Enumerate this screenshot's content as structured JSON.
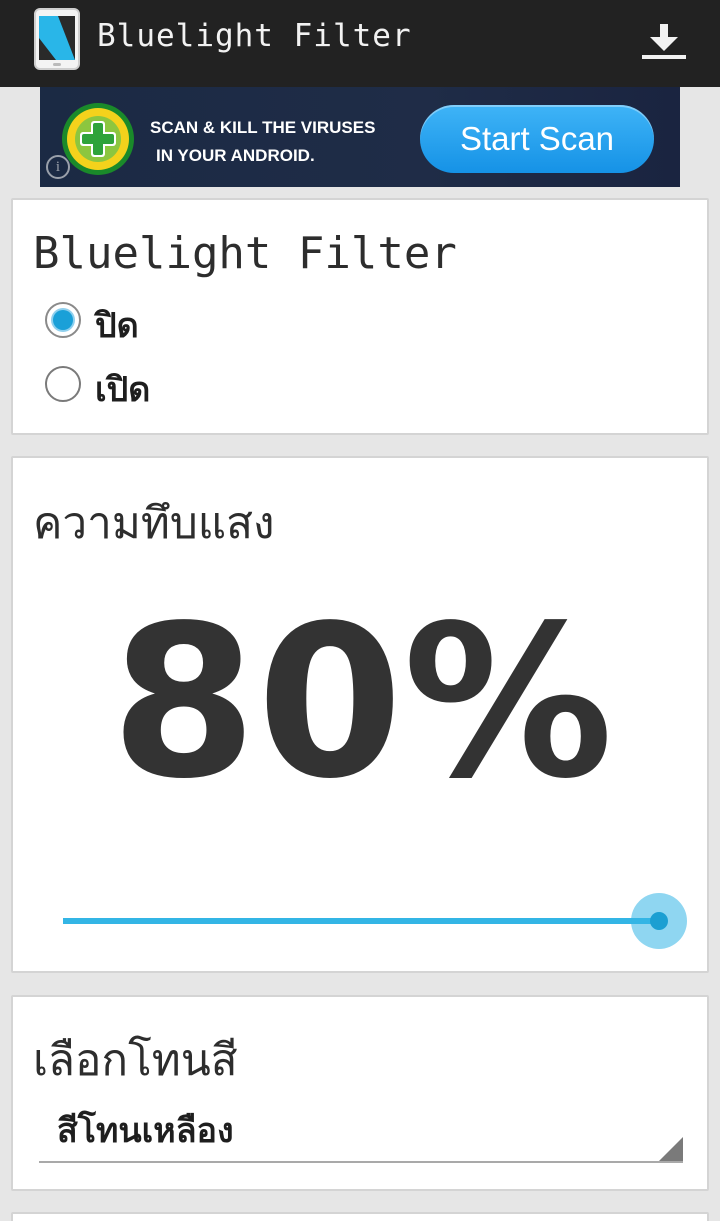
{
  "app_bar": {
    "title": "Bluelight Filter",
    "icon": "phone-icon",
    "action_icon": "download-icon"
  },
  "ad_banner": {
    "line1": "SCAN & KILL THE VIRUSES",
    "line2": "IN YOUR ANDROID.",
    "button_label": "Start Scan",
    "info_icon": "i"
  },
  "filter_card": {
    "title": "Bluelight Filter",
    "options": [
      {
        "label": "ปิด",
        "checked": true
      },
      {
        "label": "เปิด",
        "checked": false
      }
    ]
  },
  "opacity_card": {
    "title": "ความทึบแสง",
    "value_label": "80%",
    "slider_value": 1.0
  },
  "color_card": {
    "title": "เลือกโทนสี",
    "selected": "สีโทนเหลือง"
  },
  "colors": {
    "accent": "#33b5e5",
    "topbar": "#222222",
    "background": "#e6e6e6"
  }
}
